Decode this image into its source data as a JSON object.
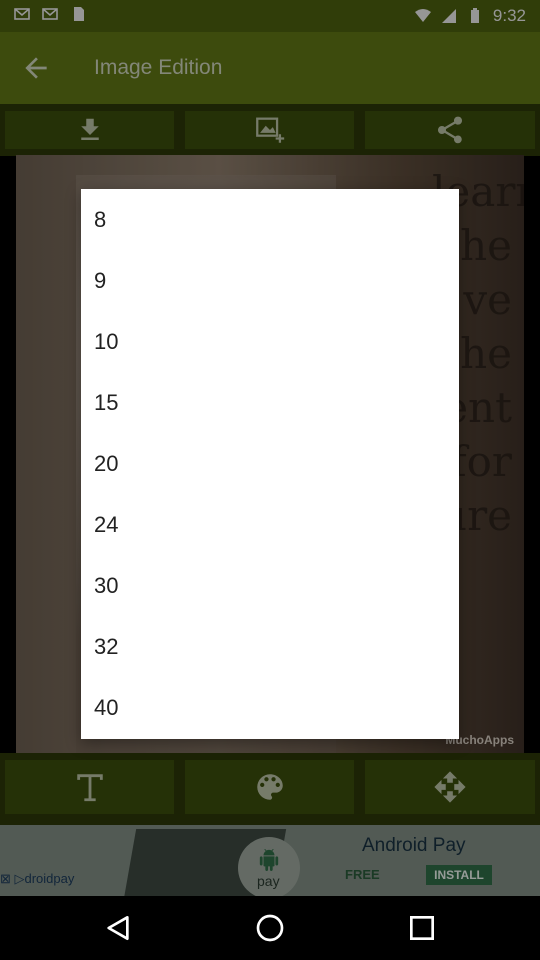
{
  "status_bar": {
    "time": "9:32"
  },
  "app_bar": {
    "title": "Image Edition"
  },
  "toolbar_top": {
    "icons": [
      "download-icon",
      "add-image-icon",
      "share-icon"
    ]
  },
  "toolbar_bottom": {
    "icons": [
      "text-icon",
      "palette-icon",
      "move-icon"
    ]
  },
  "canvas": {
    "quote_lines": [
      "learn",
      "he",
      "ve",
      "he",
      "ent",
      "for",
      "ure"
    ],
    "brand": "MuchoApps"
  },
  "ad": {
    "left_text": "⊠ ▷droidpay",
    "title": "Android Pay",
    "free": "FREE",
    "install": "INSTALL",
    "pay_label": "pay"
  },
  "popup": {
    "options": [
      "8",
      "9",
      "10",
      "15",
      "20",
      "24",
      "30",
      "32",
      "40"
    ]
  },
  "colors": {
    "app_bar": "#5e7414",
    "toolbar": "#2b3609",
    "toolbar_button": "#3a4c0b",
    "popup": "#ffffff"
  }
}
